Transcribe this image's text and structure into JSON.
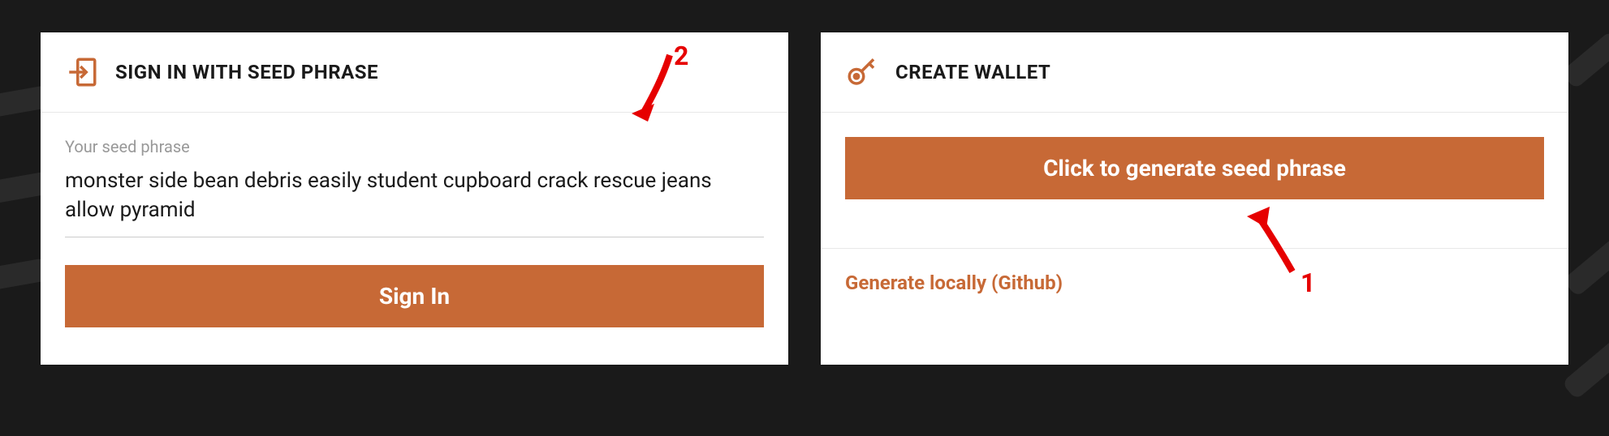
{
  "colors": {
    "accent": "#c76936",
    "background": "#1a1a1a",
    "card_bg": "#ffffff",
    "annotation": "#e60000"
  },
  "signin": {
    "title": "SIGN IN WITH SEED PHRASE",
    "input_label": "Your seed phrase",
    "input_value": "monster side bean debris easily student cupboard crack rescue jeans allow pyramid",
    "button_label": "Sign In",
    "icon": "login-icon"
  },
  "create": {
    "title": "CREATE WALLET",
    "button_label": "Click to generate seed phrase",
    "link_label": "Generate locally (Github)",
    "icon": "key-icon"
  },
  "annotations": {
    "one": "1",
    "two": "2"
  }
}
